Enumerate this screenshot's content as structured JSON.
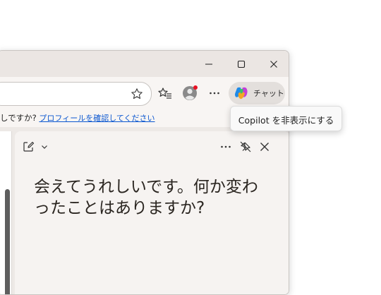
{
  "window": {
    "controls": {
      "minimize": "minimize-icon",
      "maximize": "maximize-icon",
      "close": "close-icon"
    }
  },
  "toolbar": {
    "favorite_icon": "star-icon",
    "favorites_icon": "favorites-icon",
    "profile_icon": "profile-avatar",
    "more_icon": "more-icon",
    "chat_label": "チャット",
    "copilot_icon": "copilot-icon"
  },
  "infobar": {
    "text": "しですか? ",
    "link": "プロフィールを確認してください"
  },
  "copilot_pane": {
    "new_chat_icon": "compose-icon",
    "dropdown_icon": "chevron-down-icon",
    "more_icon": "more-icon",
    "unpin_icon": "unpin-icon",
    "close_icon": "close-icon",
    "message": "会えてうれしいです。何か変わったことはありますか?"
  },
  "tooltip": {
    "text": "Copilot を非表示にする"
  },
  "colors": {
    "titlebar": "#ebe6e3",
    "toolbar": "#f8f5f3",
    "link": "#0b57d0",
    "profile_badge": "#e81123"
  }
}
